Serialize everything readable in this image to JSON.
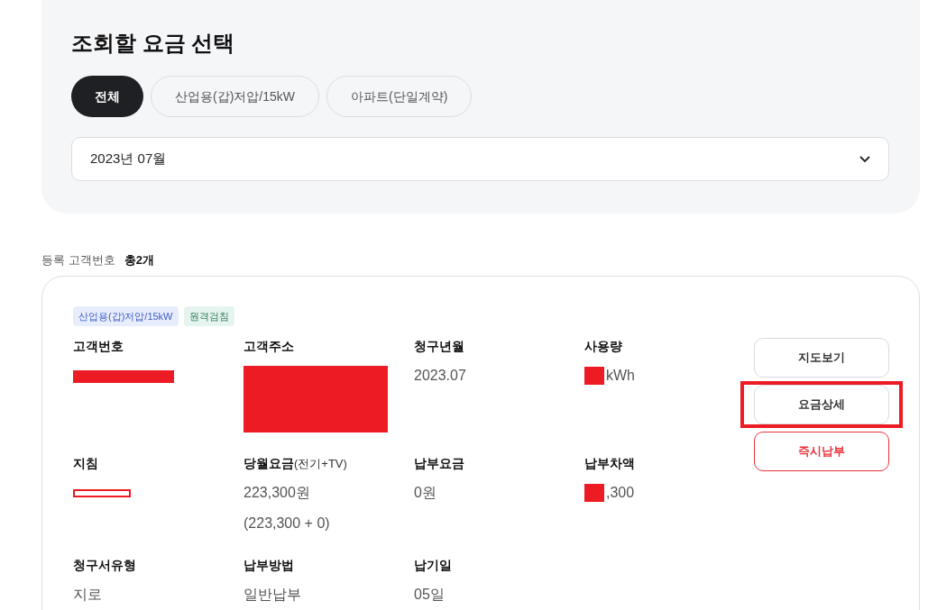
{
  "selector": {
    "title": "조회할 요금 선택",
    "tabs": [
      {
        "label": "전체",
        "selected": true
      },
      {
        "label": "산업용(갑)저압/15kW",
        "selected": false
      },
      {
        "label": "아파트(단일계약)",
        "selected": false
      }
    ],
    "month_select": {
      "value": "2023년 07월"
    }
  },
  "list": {
    "label": "등록 고객번호",
    "count": "총2개"
  },
  "account": {
    "tags": [
      {
        "label": "산업용(갑)저압/15kW",
        "kind": "rate"
      },
      {
        "label": "원격검침",
        "kind": "meter"
      }
    ],
    "fields": [
      {
        "label": "고객번호",
        "kind": "redactedline"
      },
      {
        "label": "고객주소",
        "kind": "redactedblock"
      },
      {
        "label": "청구년월",
        "value": "2023.07"
      },
      {
        "label": "사용량",
        "value": "kWh",
        "kind": "redactedprefix"
      },
      {
        "label": "지침",
        "kind": "redactedstrike"
      },
      {
        "label": "당월요금",
        "label_note": "(전기+TV)",
        "value": "223,300원",
        "sub": "(223,300 + 0)"
      },
      {
        "label": "납부요금",
        "value": "0원"
      },
      {
        "label": "납부차액",
        "value": ",300",
        "kind": "redactedprefix"
      },
      {
        "label": "청구서유형",
        "value": "지로"
      },
      {
        "label": "납부방법",
        "value": "일반납부"
      },
      {
        "label": "납기일",
        "value": "05일"
      }
    ],
    "buttons": [
      {
        "label": "지도보기",
        "kind": "normal",
        "highlighted": false
      },
      {
        "label": "요금상세",
        "kind": "normal",
        "highlighted": true
      },
      {
        "label": "즉시납부",
        "kind": "danger",
        "highlighted": false
      }
    ]
  }
}
